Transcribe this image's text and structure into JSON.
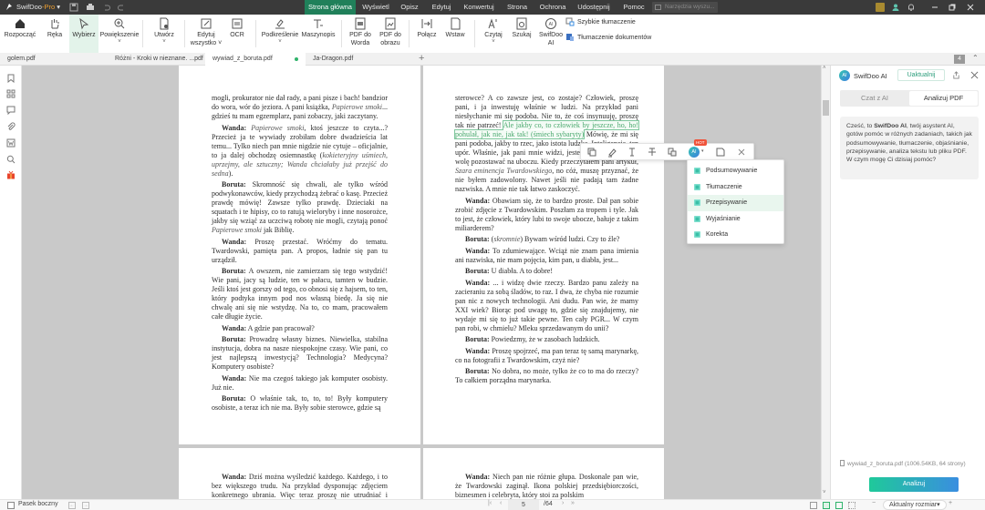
{
  "app": {
    "name": "SwifDoo",
    "edition": "Pro"
  },
  "menu": [
    "Strona główna",
    "Wyświetl",
    "Opisz",
    "Edytuj",
    "Konwertuj",
    "Strona",
    "Ochrona",
    "Udostępnij",
    "Pomoc"
  ],
  "search": {
    "placeholder": "Narzędzia wyszu..."
  },
  "toolbar": [
    {
      "label": "Rozpocząć",
      "icon": "home"
    },
    {
      "label": "Ręka",
      "icon": "hand"
    },
    {
      "label": "Wybierz",
      "icon": "cursor",
      "active": true
    },
    {
      "label": "Powiększenie",
      "icon": "zoom",
      "caret": true
    },
    {
      "label": "Utwórz",
      "icon": "create",
      "caret": true
    },
    {
      "label": "Edytuj\nwszystko ˅",
      "icon": "edit"
    },
    {
      "label": "OCR",
      "icon": "ocr"
    },
    {
      "label": "Podkreślenie",
      "icon": "highlight",
      "caret": true
    },
    {
      "label": "Maszynopis",
      "icon": "typewriter"
    },
    {
      "label": "PDF do\nWorda",
      "icon": "pdf-word"
    },
    {
      "label": "PDF do\nobrazu",
      "icon": "pdf-image"
    },
    {
      "label": "Połącz",
      "icon": "merge"
    },
    {
      "label": "Wstaw",
      "icon": "insert"
    },
    {
      "label": "Czytaj",
      "icon": "read",
      "caret": true
    },
    {
      "label": "Szukaj",
      "icon": "search"
    },
    {
      "label": "SwifDoo\nAI",
      "icon": "ai"
    }
  ],
  "translate": {
    "quick": "Szybkie tłumaczenie",
    "docs": "Tłumaczenie dokumentów"
  },
  "tabs": [
    {
      "label": "golem.pdf"
    },
    {
      "label": "Różni - Kroki w nieznane. ...pdf"
    },
    {
      "label": "wywiad_z_boruta.pdf",
      "active": true
    },
    {
      "label": "Ja-Dragon.pdf"
    }
  ],
  "tab_count": "4",
  "pages": {
    "left": [
      {
        "cont": true,
        "runs": [
          [
            "mogli, prokurator nie dał rady, a pani pisze i bach! bandzior do wora, wór do jeziora. A pani książka, ",
            ""
          ],
          [
            "Papierowe smoki",
            "i"
          ],
          [
            "... gdzieś tu mam egzemplarz, pani zobaczy, jaki zaczytany.",
            ""
          ]
        ]
      },
      {
        "runs": [
          [
            "Wanda:",
            "b"
          ],
          [
            " ",
            ""
          ],
          [
            "Papierowe smoki",
            "i"
          ],
          [
            ", ktoś jeszcze to czyta...? Przecież ja te wywiady zrobiłam dobre dwadzieścia lat temu... Tylko niech pan mnie nigdzie nie cytuje – oficjalnie, to ja dalej obchodzę osiemnastkę (",
            ""
          ],
          [
            "kokieteryjny uśmiech, uprzejmy, ale sztuczny; Wanda chciałaby już przejść do sedna",
            "i"
          ],
          [
            ").",
            ""
          ]
        ]
      },
      {
        "runs": [
          [
            "Boruta:",
            "b"
          ],
          [
            " Skromność się chwali, ale tylko wśród podwykonawców, kiedy przychodzą żebrać o kasę. Przecież prawdę mówię! Zawsze tylko prawdę. Dzieciaki na squatach i te hipisy, co to ratują wieloryby i inne nosorożce, jakby się wziąć za uczciwą robotę nie mogli, czytają ponoć ",
            ""
          ],
          [
            "Papierowe smoki",
            "i"
          ],
          [
            " jak Biblię.",
            ""
          ]
        ]
      },
      {
        "runs": [
          [
            "Wanda:",
            "b"
          ],
          [
            " Proszę przestać. Wróćmy do tematu. Twardowski, pamięta pan. A propos, ładnie się pan tu urządził.",
            ""
          ]
        ]
      },
      {
        "runs": [
          [
            "Boruta:",
            "b"
          ],
          [
            " A owszem, nie zamierzam się tego wstydzić! Wie pani, jacy są ludzie, ten w pałacu, tamten w budzie. Jeśli ktoś jest gorszy od tego, co obnosi się z hajsem, to ten, który podtyka innym pod nos własną biedę. Ja się nie chwalę ani się nie wstydzę. Na to, co mam, pracowałem całe długie życie.",
            ""
          ]
        ]
      },
      {
        "runs": [
          [
            "Wanda:",
            "b"
          ],
          [
            " A gdzie pan pracował?",
            ""
          ]
        ]
      },
      {
        "runs": [
          [
            "Boruta:",
            "b"
          ],
          [
            " Prowadzę własny biznes. Niewielka, stabilna instytucja, dobra na nasze niespokojne czasy. Wie pani, co jest najlepszą inwestycją? Technologia? Medycyna? Komputery osobiste?",
            ""
          ]
        ]
      },
      {
        "runs": [
          [
            "Wanda:",
            "b"
          ],
          [
            " Nie ma czegoś takiego jak komputer osobisty. Już nie.",
            ""
          ]
        ]
      },
      {
        "runs": [
          [
            "Boruta:",
            "b"
          ],
          [
            " O właśnie tak, to, to, to! Były komputery osobiste, a teraz ich nie ma. Były sobie sterowce, gdzie są",
            ""
          ]
        ]
      }
    ],
    "right": [
      {
        "cont": true,
        "runs": [
          [
            "sterowce? A co zawsze jest, co zostaje? Człowiek, proszę pani, i ja inwestuję właśnie w ludzi. Na przykład pani niesłychanie mi się podoba. Nie to, że coś insynuuję, proszę tak nie patrzeć! ",
            ""
          ],
          [
            "Ale jakby co, to człowiek by jeszcze, ho, ho! pohulał, jak nie, jak tak! (śmiech sybaryty)",
            "h"
          ],
          [
            " Mówię, że mi się pani podoba, jakby to rzec, jako istota ludzka. Inteligencja, ten upór. Właśnie, jak pani mnie widzi, jestem skromną osobą i wolę pozostawać na uboczu. Kiedy przeczytałem pani artykuł, ",
            ""
          ],
          [
            "Szara eminencja Twardowskiego",
            "i"
          ],
          [
            ", no cóż, muszę przyznać, że nie byłem zadowolony. Nawet jeśli nie padają tam żadne nazwiska. A mnie nie tak łatwo zaskoczyć.",
            ""
          ]
        ]
      },
      {
        "runs": [
          [
            "Wanda:",
            "b"
          ],
          [
            " Obawiam się, że to bardzo proste. Dał pan sobie zrobić zdjęcie z Twardowskim. Poszłam za tropem i tyle. Jak to jest, że człowiek, który lubi to swoje ubocze, bałuje z takim miliarderem?",
            ""
          ]
        ]
      },
      {
        "runs": [
          [
            "Boruta:",
            "b"
          ],
          [
            " (",
            ""
          ],
          [
            "skromnie",
            "i"
          ],
          [
            ") Bywam wśród ludzi. Czy to źle?",
            ""
          ]
        ]
      },
      {
        "runs": [
          [
            "Wanda:",
            "b"
          ],
          [
            " To zdumiewające. Wciąż nie znam pana imienia ani nazwiska, nie mam pojęcia, kim pan, u diabła, jest...",
            ""
          ]
        ]
      },
      {
        "runs": [
          [
            "Boruta:",
            "b"
          ],
          [
            " U diabła. A to dobre!",
            ""
          ]
        ]
      },
      {
        "runs": [
          [
            "Wanda:",
            "b"
          ],
          [
            " ... i widzę dwie rzeczy. Bardzo panu zależy na zacieraniu za sobą śladów, to raz. I dwa, że chyba nie rozumie pan nic z nowych technologii. Ani dudu. Pan wie, że mamy XXI wiek? Biorąc pod uwagę to, gdzie się znajdujemy, nie wydaje mi się to już takie pewne. Ten cały PGR... W czym pan robi, w chmielu? Mleku sprzedawanym do unii?",
            ""
          ]
        ]
      },
      {
        "runs": [
          [
            "Boruta:",
            "b"
          ],
          [
            " Powiedzmy, że w zasobach ludzkich.",
            ""
          ]
        ]
      },
      {
        "runs": [
          [
            "Wanda:",
            "b"
          ],
          [
            " Proszę spojrzeć, ma pan teraz tę samą marynarkę, co na fotografii z Twardowskim, czyż nie?",
            ""
          ]
        ]
      },
      {
        "runs": [
          [
            "Boruta:",
            "b"
          ],
          [
            " No dobra, no może, tylko że co to ma do rzeczy? To całkiem porządna marynarka.",
            ""
          ]
        ]
      }
    ],
    "left2": [
      {
        "runs": [
          [
            "Wanda:",
            "b"
          ],
          [
            " Dziś można wyśledzić każdego. Każdego, i to bez większego trudu. Na przykład dysponując zdjęciem konkretnego ubrania. Więc teraz proszę nie utrudniać i przestać.",
            ""
          ]
        ]
      }
    ],
    "right2": [
      {
        "runs": [
          [
            "Wanda:",
            "b"
          ],
          [
            " Niech pan nie różnie głupa. Doskonale pan wie, że Twardowski zaginął. Ikona polskiej przedsiębiorczości, biznesmen i celebryta, który stoi za polskim",
            ""
          ]
        ]
      }
    ]
  },
  "ai_toolbar": {
    "hot_badge": "HOT"
  },
  "ai_menu": [
    "Podsumowywanie",
    "Tłumaczenie",
    "Przepisywanie",
    "Wyjaśnianie",
    "Korekta"
  ],
  "ai_menu_selected": 2,
  "panel": {
    "title": "SwifDoo AI",
    "upgrade": "Uaktualnij",
    "tabs": [
      "Czat z AI",
      "Analizuj PDF"
    ],
    "active_tab": 1,
    "greeting_pre": "Cześć, to ",
    "greeting_bold": "SwifDoo AI",
    "greeting_post": ", twój asystent AI, gotów pomóc w różnych zadaniach, takich jak podsumowywanie, tłumaczenie, objaśnianie, przepisywanie, analiza tekstu lub pliku PDF. W czym mogę Ci dzisiaj pomóc?",
    "file_info": "wywiad_z_boruta.pdf (1006.54KB, 64 strony)",
    "analyze_button": "Analizuj"
  },
  "status": {
    "sidebar_label": "Pasek boczny",
    "page_current": "5",
    "page_total": "/64",
    "zoom_mode": "Aktualny rozmiar"
  },
  "colors": {
    "accent": "#20805a",
    "highlight": "#4aa86e",
    "ai": "#3bbfa7",
    "button_from": "#1fc99a",
    "button_to": "#3a8ee0"
  }
}
